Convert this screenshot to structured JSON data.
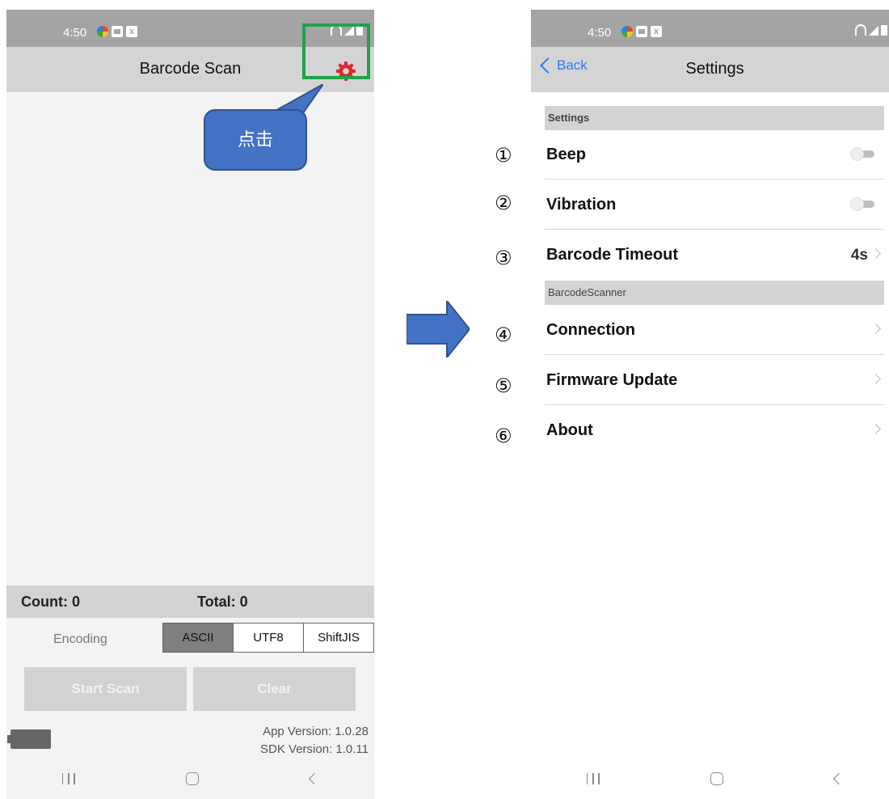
{
  "left_screen": {
    "status": {
      "time": "4:50"
    },
    "header": {
      "title": "Barcode Scan"
    },
    "callout": {
      "text": "点击"
    },
    "stats": {
      "count": "Count: 0",
      "total": "Total: 0"
    },
    "encoding": {
      "label": "Encoding",
      "options": [
        "ASCII",
        "UTF8",
        "ShiftJIS"
      ],
      "selected": "ASCII"
    },
    "buttons": {
      "start": "Start Scan",
      "clear": "Clear"
    },
    "versions": {
      "app": "App Version: 1.0.28",
      "sdk": "SDK Version: 1.0.11"
    }
  },
  "right_screen": {
    "status": {
      "time": "4:50"
    },
    "header": {
      "back": "Back",
      "title": "Settings"
    },
    "sections": [
      {
        "title": "Settings"
      },
      {
        "title": "BarcodeScanner"
      }
    ],
    "rows": [
      {
        "marker": "①",
        "label": "Beep",
        "control": "toggle",
        "on": false
      },
      {
        "marker": "②",
        "label": "Vibration",
        "control": "toggle",
        "on": false
      },
      {
        "marker": "③",
        "label": "Barcode Timeout",
        "value": "4s"
      },
      {
        "marker": "④",
        "label": "Connection"
      },
      {
        "marker": "⑤",
        "label": "Firmware Update"
      },
      {
        "marker": "⑥",
        "label": "About"
      }
    ]
  },
  "colors": {
    "status_bar": "#a4a4a4",
    "header_bar": "#d4d4d4",
    "gear": "#e0282c",
    "highlight_box": "#1fa24a",
    "callout": "#4472c4",
    "arrow": "#4472c4",
    "link": "#2b7de9"
  }
}
